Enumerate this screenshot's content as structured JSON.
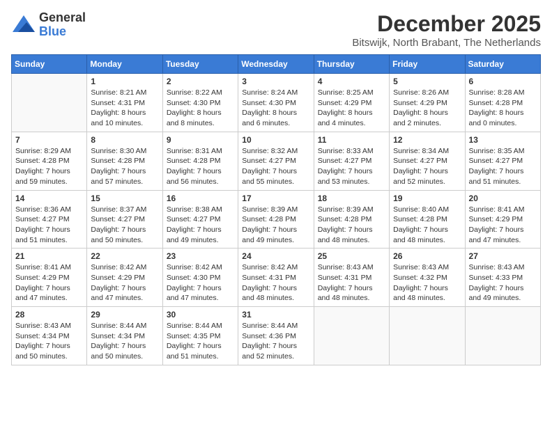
{
  "header": {
    "logo_line1": "General",
    "logo_line2": "Blue",
    "month_year": "December 2025",
    "location": "Bitswijk, North Brabant, The Netherlands"
  },
  "days_of_week": [
    "Sunday",
    "Monday",
    "Tuesday",
    "Wednesday",
    "Thursday",
    "Friday",
    "Saturday"
  ],
  "weeks": [
    [
      {
        "day": "",
        "info": ""
      },
      {
        "day": "1",
        "info": "Sunrise: 8:21 AM\nSunset: 4:31 PM\nDaylight: 8 hours\nand 10 minutes."
      },
      {
        "day": "2",
        "info": "Sunrise: 8:22 AM\nSunset: 4:30 PM\nDaylight: 8 hours\nand 8 minutes."
      },
      {
        "day": "3",
        "info": "Sunrise: 8:24 AM\nSunset: 4:30 PM\nDaylight: 8 hours\nand 6 minutes."
      },
      {
        "day": "4",
        "info": "Sunrise: 8:25 AM\nSunset: 4:29 PM\nDaylight: 8 hours\nand 4 minutes."
      },
      {
        "day": "5",
        "info": "Sunrise: 8:26 AM\nSunset: 4:29 PM\nDaylight: 8 hours\nand 2 minutes."
      },
      {
        "day": "6",
        "info": "Sunrise: 8:28 AM\nSunset: 4:28 PM\nDaylight: 8 hours\nand 0 minutes."
      }
    ],
    [
      {
        "day": "7",
        "info": "Sunrise: 8:29 AM\nSunset: 4:28 PM\nDaylight: 7 hours\nand 59 minutes."
      },
      {
        "day": "8",
        "info": "Sunrise: 8:30 AM\nSunset: 4:28 PM\nDaylight: 7 hours\nand 57 minutes."
      },
      {
        "day": "9",
        "info": "Sunrise: 8:31 AM\nSunset: 4:28 PM\nDaylight: 7 hours\nand 56 minutes."
      },
      {
        "day": "10",
        "info": "Sunrise: 8:32 AM\nSunset: 4:27 PM\nDaylight: 7 hours\nand 55 minutes."
      },
      {
        "day": "11",
        "info": "Sunrise: 8:33 AM\nSunset: 4:27 PM\nDaylight: 7 hours\nand 53 minutes."
      },
      {
        "day": "12",
        "info": "Sunrise: 8:34 AM\nSunset: 4:27 PM\nDaylight: 7 hours\nand 52 minutes."
      },
      {
        "day": "13",
        "info": "Sunrise: 8:35 AM\nSunset: 4:27 PM\nDaylight: 7 hours\nand 51 minutes."
      }
    ],
    [
      {
        "day": "14",
        "info": "Sunrise: 8:36 AM\nSunset: 4:27 PM\nDaylight: 7 hours\nand 51 minutes."
      },
      {
        "day": "15",
        "info": "Sunrise: 8:37 AM\nSunset: 4:27 PM\nDaylight: 7 hours\nand 50 minutes."
      },
      {
        "day": "16",
        "info": "Sunrise: 8:38 AM\nSunset: 4:27 PM\nDaylight: 7 hours\nand 49 minutes."
      },
      {
        "day": "17",
        "info": "Sunrise: 8:39 AM\nSunset: 4:28 PM\nDaylight: 7 hours\nand 49 minutes."
      },
      {
        "day": "18",
        "info": "Sunrise: 8:39 AM\nSunset: 4:28 PM\nDaylight: 7 hours\nand 48 minutes."
      },
      {
        "day": "19",
        "info": "Sunrise: 8:40 AM\nSunset: 4:28 PM\nDaylight: 7 hours\nand 48 minutes."
      },
      {
        "day": "20",
        "info": "Sunrise: 8:41 AM\nSunset: 4:29 PM\nDaylight: 7 hours\nand 47 minutes."
      }
    ],
    [
      {
        "day": "21",
        "info": "Sunrise: 8:41 AM\nSunset: 4:29 PM\nDaylight: 7 hours\nand 47 minutes."
      },
      {
        "day": "22",
        "info": "Sunrise: 8:42 AM\nSunset: 4:29 PM\nDaylight: 7 hours\nand 47 minutes."
      },
      {
        "day": "23",
        "info": "Sunrise: 8:42 AM\nSunset: 4:30 PM\nDaylight: 7 hours\nand 47 minutes."
      },
      {
        "day": "24",
        "info": "Sunrise: 8:42 AM\nSunset: 4:31 PM\nDaylight: 7 hours\nand 48 minutes."
      },
      {
        "day": "25",
        "info": "Sunrise: 8:43 AM\nSunset: 4:31 PM\nDaylight: 7 hours\nand 48 minutes."
      },
      {
        "day": "26",
        "info": "Sunrise: 8:43 AM\nSunset: 4:32 PM\nDaylight: 7 hours\nand 48 minutes."
      },
      {
        "day": "27",
        "info": "Sunrise: 8:43 AM\nSunset: 4:33 PM\nDaylight: 7 hours\nand 49 minutes."
      }
    ],
    [
      {
        "day": "28",
        "info": "Sunrise: 8:43 AM\nSunset: 4:34 PM\nDaylight: 7 hours\nand 50 minutes."
      },
      {
        "day": "29",
        "info": "Sunrise: 8:44 AM\nSunset: 4:34 PM\nDaylight: 7 hours\nand 50 minutes."
      },
      {
        "day": "30",
        "info": "Sunrise: 8:44 AM\nSunset: 4:35 PM\nDaylight: 7 hours\nand 51 minutes."
      },
      {
        "day": "31",
        "info": "Sunrise: 8:44 AM\nSunset: 4:36 PM\nDaylight: 7 hours\nand 52 minutes."
      },
      {
        "day": "",
        "info": ""
      },
      {
        "day": "",
        "info": ""
      },
      {
        "day": "",
        "info": ""
      }
    ]
  ]
}
